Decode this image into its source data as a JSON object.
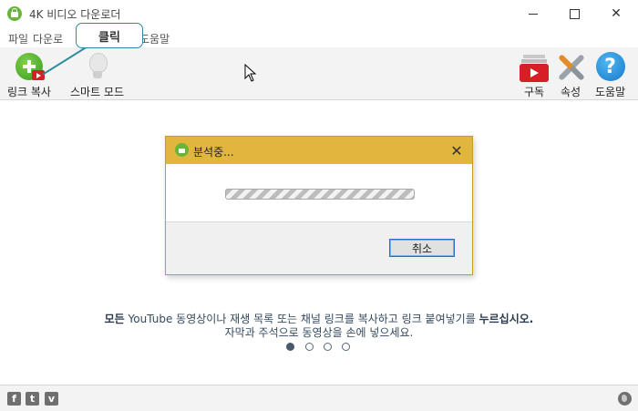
{
  "window": {
    "title": "4K 비디오 다운로더"
  },
  "menu": [
    "파일",
    "다운로",
    "도움말"
  ],
  "toolbar": {
    "copy_link": "링크 복사",
    "smart_mode": "스마트 모드",
    "subscribe": "구독",
    "preferences": "속성",
    "help": "도움말",
    "help_glyph": "?"
  },
  "callout": {
    "text": "클릭"
  },
  "dialog": {
    "title": "분석중...",
    "close_glyph": "✕",
    "cancel_label": "취소",
    "progress_state": "indeterminate"
  },
  "hint": {
    "line1_prefix": "모든",
    "line1_mid": " YouTube 동영상이나 재생 목록 또는 채널 링크를 복사하고 링크 붙여넣기를 ",
    "line1_suffix": "누르십시오.",
    "line2": "자막과 주석으로 동영상을 손에 넣으세요."
  },
  "pager": {
    "count": 4,
    "active_index": 0
  },
  "statusbar": {
    "facebook_glyph": "f",
    "twitter_glyph": "t",
    "vimeo_glyph": "v"
  },
  "icons": {
    "app": "4k-downloader-icon",
    "copy_link": "add-link-icon",
    "smart_mode": "lightbulb-icon",
    "subscribe": "youtube-subscribe-icon",
    "preferences": "tools-icon",
    "help": "help-icon",
    "language": "globe-icon"
  },
  "colors": {
    "dialog_title_bg": "#e1b63c",
    "callout_border": "#2a8a9c",
    "accent_green": "#6ab43e"
  }
}
